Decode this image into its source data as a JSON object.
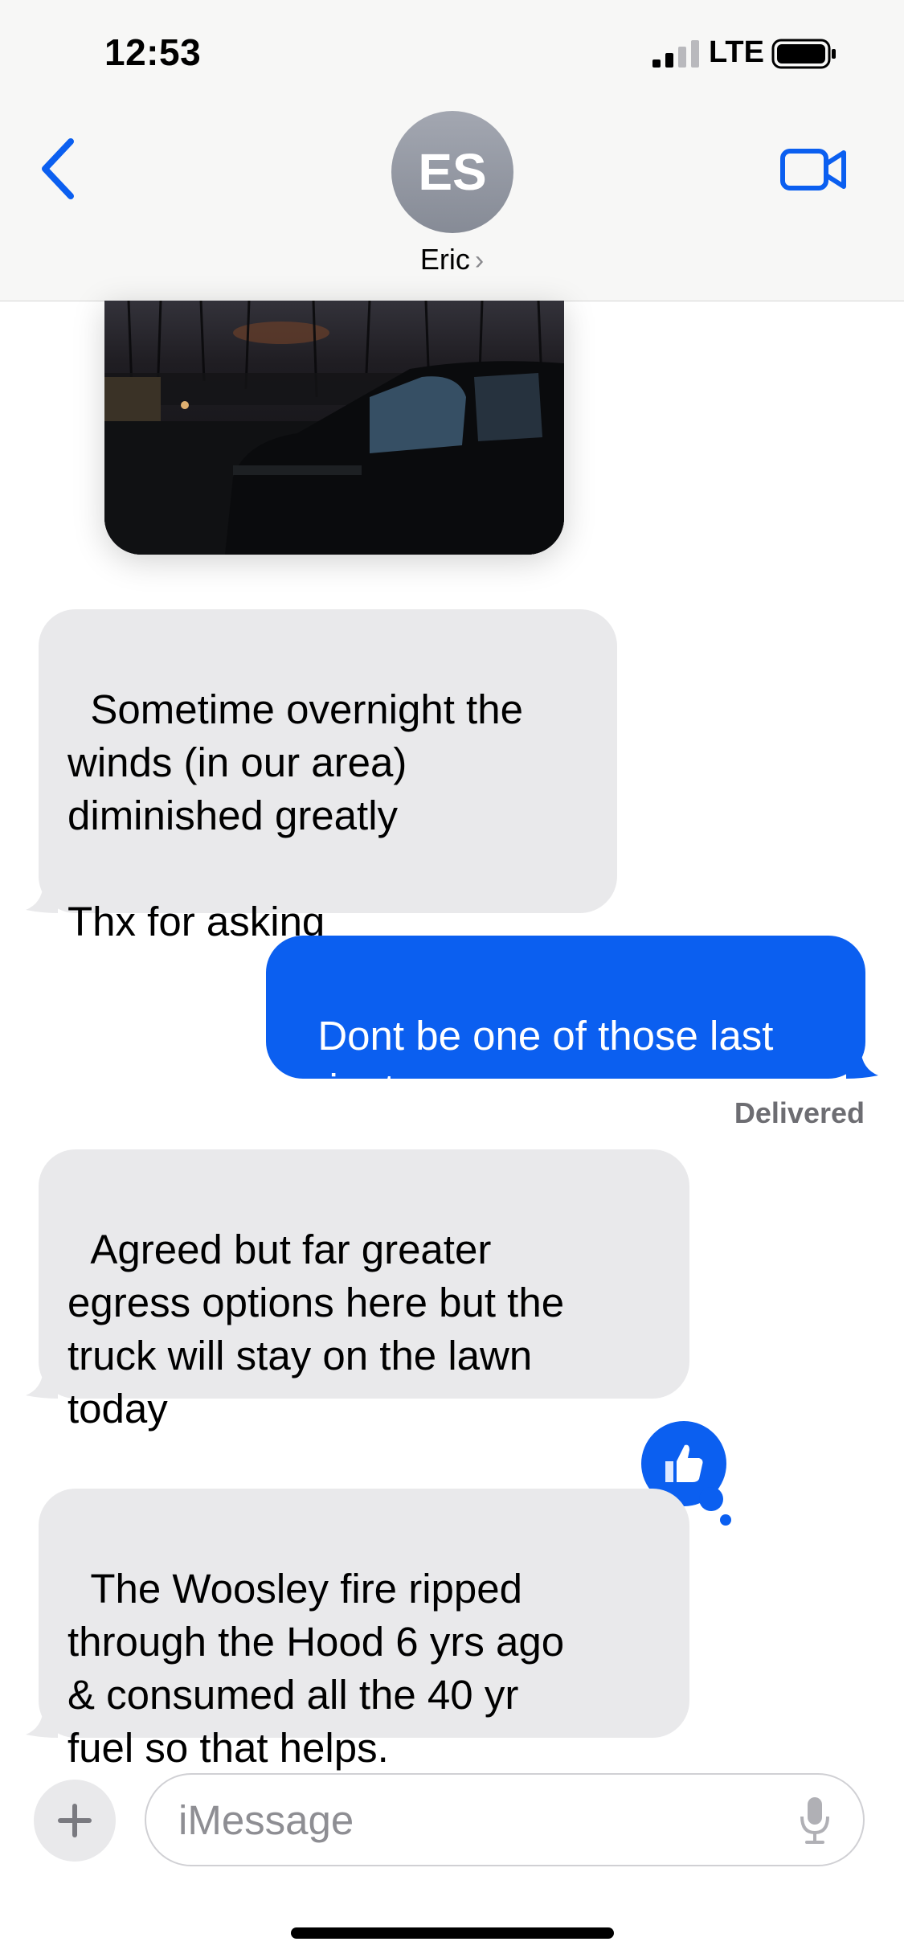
{
  "status_bar": {
    "time": "12:53",
    "network": "LTE"
  },
  "header": {
    "avatar_initials": "ES",
    "contact_name": "Eric",
    "chevron": "›"
  },
  "messages": [
    {
      "direction": "received",
      "text": "Sometime overnight the\nwinds (in our area)\ndiminished greatly\n\nThx for asking"
    },
    {
      "direction": "sent",
      "text": "Dont be one of those last\nminute evacuees"
    },
    {
      "direction": "received",
      "text": "Agreed but far greater\negress options here but the\ntruck will stay on the lawn\ntoday"
    },
    {
      "direction": "received",
      "text": "The Woosley fire ripped\nthrough the Hood 6 yrs ago\n& consumed all the 40 yr\nfuel so that helps."
    }
  ],
  "delivered_label": "Delivered",
  "input": {
    "placeholder": "iMessage"
  },
  "colors": {
    "accent": "#0b5ff0",
    "received_bubble": "#e9e9eb",
    "header_bg": "#f7f7f6"
  }
}
